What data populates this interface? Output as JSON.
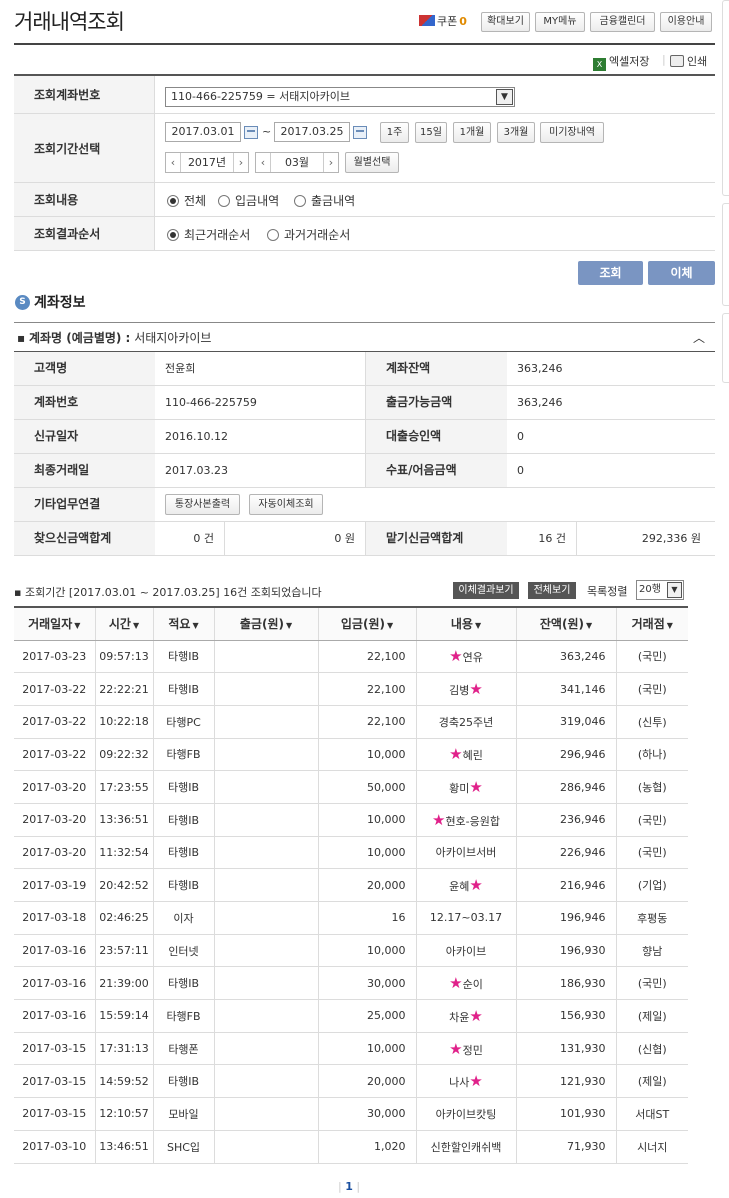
{
  "header": {
    "title": "거래내역조회",
    "coupon_label": "쿠폰",
    "coupon_count": "0",
    "buttons": [
      "확대보기",
      "MY메뉴",
      "금융캘린더",
      "이용안내"
    ]
  },
  "utility": {
    "excel": "엑셀저장",
    "print": "인쇄"
  },
  "form": {
    "account_label": "조회계좌번호",
    "account_value": "110-466-225759 = 서태지아카이브",
    "period_label": "조회기간선택",
    "date_from": "2017.03.01",
    "tilde": "~",
    "date_to": "2017.03.25",
    "quick": [
      "1주",
      "15일",
      "1개월",
      "3개월",
      "미기장내역"
    ],
    "year": "2017년",
    "month": "03월",
    "month_btn": "월별선택",
    "content_label": "조회내용",
    "content_opts": [
      "전체",
      "입금내역",
      "출금내역"
    ],
    "order_label": "조회결과순서",
    "order_opts": [
      "최근거래순서",
      "과거거래순서"
    ],
    "search_btn": "조회",
    "transfer_btn": "이체"
  },
  "account": {
    "section_title": "계좌정보",
    "name_label": "계좌명 (예금별명) :",
    "name_value": "서태지아카이브",
    "rows": {
      "customer_label": "고객명",
      "customer": "전윤희",
      "balance_label": "계좌잔액",
      "balance": "363,246",
      "acctno_label": "계좌번호",
      "acctno": "110-466-225759",
      "avail_label": "출금가능금액",
      "avail": "363,246",
      "newdate_label": "신규일자",
      "newdate": "2016.10.12",
      "loan_label": "대출승인액",
      "loan": "0",
      "lastdate_label": "최종거래일",
      "lastdate": "2017.03.23",
      "check_label": "수표/어음금액",
      "check": "0",
      "etc_label": "기타업무연결",
      "etc_btn1": "통장사본출력",
      "etc_btn2": "자동이체조회",
      "withdraw_sum_label": "찾으신금액합계",
      "withdraw_cnt": "0 건",
      "withdraw_amt": "0 원",
      "deposit_sum_label": "맡기신금액합계",
      "deposit_cnt": "16 건",
      "deposit_amt": "292,336 원"
    }
  },
  "list": {
    "summary": "조회기간 [2017.03.01 ~ 2017.03.25] 16건 조회되었습니다",
    "result_btn": "이체결과보기",
    "all_btn": "전체보기",
    "sort_label": "목록정렬",
    "sort_value": "20행",
    "columns": [
      "거래일자",
      "시간",
      "적요",
      "출금(원)",
      "입금(원)",
      "내용",
      "잔액(원)",
      "거래점"
    ],
    "rows": [
      [
        "2017-03-23",
        "09:57:13",
        "타행IB",
        "",
        "22,100",
        "★연유",
        "363,246",
        "(국민)"
      ],
      [
        "2017-03-22",
        "22:22:21",
        "타행IB",
        "",
        "22,100",
        "김병★",
        "341,146",
        "(국민)"
      ],
      [
        "2017-03-22",
        "10:22:18",
        "타행PC",
        "",
        "22,100",
        "경축25주년",
        "319,046",
        "(신투)"
      ],
      [
        "2017-03-22",
        "09:22:32",
        "타행FB",
        "",
        "10,000",
        "★혜린",
        "296,946",
        "(하나)"
      ],
      [
        "2017-03-20",
        "17:23:55",
        "타행IB",
        "",
        "50,000",
        "황미★",
        "286,946",
        "(농협)"
      ],
      [
        "2017-03-20",
        "13:36:51",
        "타행IB",
        "",
        "10,000",
        "★현호-응원합",
        "236,946",
        "(국민)"
      ],
      [
        "2017-03-20",
        "11:32:54",
        "타행IB",
        "",
        "10,000",
        "아카이브서버",
        "226,946",
        "(국민)"
      ],
      [
        "2017-03-19",
        "20:42:52",
        "타행IB",
        "",
        "20,000",
        "윤혜★",
        "216,946",
        "(기업)"
      ],
      [
        "2017-03-18",
        "02:46:25",
        "이자",
        "",
        "16",
        "12.17~03.17",
        "196,946",
        "후평동"
      ],
      [
        "2017-03-16",
        "23:57:11",
        "인터넷",
        "",
        "10,000",
        "아카이브",
        "196,930",
        "향남"
      ],
      [
        "2017-03-16",
        "21:39:00",
        "타행IB",
        "",
        "30,000",
        "★순이",
        "186,930",
        "(국민)"
      ],
      [
        "2017-03-16",
        "15:59:14",
        "타행FB",
        "",
        "25,000",
        "차윤★",
        "156,930",
        "(제일)"
      ],
      [
        "2017-03-15",
        "17:31:13",
        "타행폰",
        "",
        "10,000",
        "★정민",
        "131,930",
        "(신협)"
      ],
      [
        "2017-03-15",
        "14:59:52",
        "타행IB",
        "",
        "20,000",
        "나사★",
        "121,930",
        "(제일)"
      ],
      [
        "2017-03-15",
        "12:10:57",
        "모바일",
        "",
        "30,000",
        "아카이브캇팅",
        "101,930",
        "서대ST"
      ],
      [
        "2017-03-10",
        "13:46:51",
        "SHC입",
        "",
        "1,020",
        "신한할인캐쉬백",
        "71,930",
        "시너지"
      ]
    ]
  },
  "pager": {
    "current": "1"
  },
  "colors": {
    "primary_button": "#7a95c2",
    "star": "#e0218a",
    "dark_button": "#555555"
  }
}
